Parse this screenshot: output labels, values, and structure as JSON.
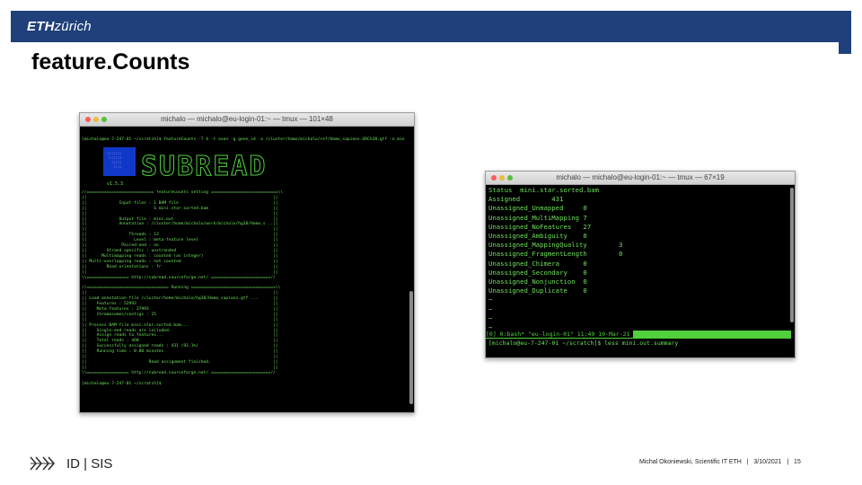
{
  "slide": {
    "logo_eth": "ETH",
    "logo_zurich": "zürich",
    "title": "feature.Counts",
    "org": "ID | SIS",
    "author": "Michal Okoniewski, Scientific IT ETH",
    "date": "3/10/2021",
    "page": "15",
    "footer_separator": "|"
  },
  "window1": {
    "title": "michalo — michalo@eu-login-01:~ — tmux — 101×48",
    "prompt_lines": [
      "[michalo@eu-7-247-01 ~/scratch]$ featureCounts -T 4 -t exon -g gene_id -a /cluster/home/michalo/ref/Homo_sapiens.GRCh38.gtf -o mini.out mini.star.sorted.bam",
      "                                     "
    ],
    "version": "v1.5.3",
    "subread": "SUBREAD",
    "logo_dots": ":::::::\n ::::::\n  :::::\n   ::::",
    "body_lines": [
      "//=========================== featureCounts setting ===========================\\\\",
      "||                                                                           ||",
      "||             Input files : 1 BAM file                                      ||",
      "||                           S mini.star.sorted.bam                          ||",
      "||                                                                           ||",
      "||             Output file : mini.out                                        ||",
      "||             Annotation : /cluster/home/michalo/work/michalo/hg38/Homo_s ..||",
      "||                                                                           ||",
      "||                 Threads : 13                                              ||",
      "||                   Level : meta-feature level                              ||",
      "||              Paired-end : no                                              ||",
      "||        Strand specific : unstranded                                       ||",
      "||      Multimapping reads : counted (as integer)                            ||",
      "|| Multi-overlapping reads : not counted                                     ||",
      "||        Read orientations : fr                                             ||",
      "||                                                                           ||",
      "\\\\================= http://subread.sourceforge.net/ ========================//",
      "",
      "//================================= Running ==================================\\\\",
      "||                                                                           ||",
      "|| Load annotation file /cluster/home/michalo/hg38/Homo_sapiens.gtf ...      ||",
      "||    Features : 52993                                                       ||",
      "||    Meta-features : 37993                                                  ||",
      "||    Chromosomes/contigs : 25                                               ||",
      "||                                                                           ||",
      "|| Process BAM file mini.star.sorted.bam...                                  ||",
      "||    Single-end reads are included.                                         ||",
      "||    Assign reads to features...                                            ||",
      "||    Total reads : 468                                                      ||",
      "||    Successfully assigned reads : 431 (92.1%)                              ||",
      "||    Running time : 0.00 minutes                                            ||",
      "||                                                                           ||",
      "||                         Read assignment finished.                         ||",
      "||                                                                           ||",
      "\\\\================= http://subread.sourceforge.net/ ========================//",
      "",
      "[michalo@eu-7-247-01 ~/scratch]$ "
    ]
  },
  "window2": {
    "title": "michalo — michalo@eu-login-01:~ — tmux — 67×19",
    "lines": [
      "Status  mini.star.sorted.bam",
      "Assigned        431",
      "Unassigned_Unmapped     0",
      "Unassigned_MultiMapping 7",
      "Unassigned_NoFeatures   27",
      "Unassigned_Ambiguity    0",
      "Unassigned_MappingQuality        3",
      "Unassigned_FragmentLength        0",
      "Unassigned_Chimera      0",
      "Unassigned_Secondary    0",
      "Unassigned_Nonjunction  0",
      "Unassigned_Duplicate    0",
      "~",
      "~",
      "~",
      "~"
    ],
    "tmux_status": "[0] 0:bash* \"eu-login-01\" 11:49 10-Mar-21 ",
    "cmd": "[michalo@eu-7-247-01 ~/scratch]$ less mini.out.summary"
  }
}
